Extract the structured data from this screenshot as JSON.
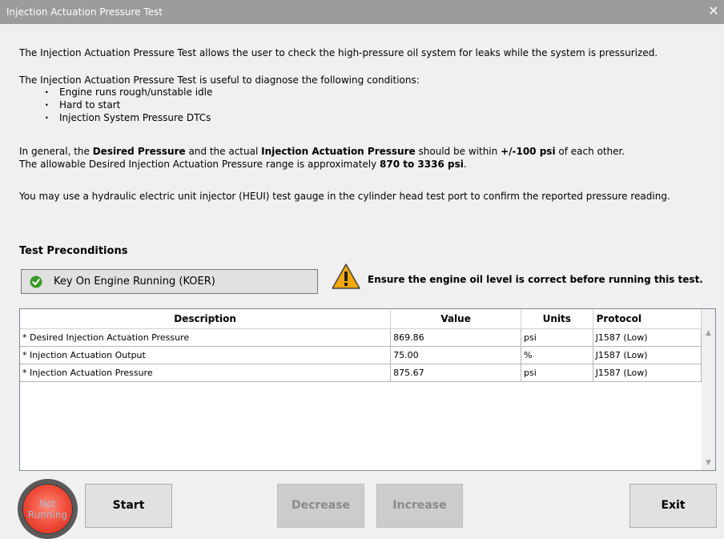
{
  "window": {
    "title": "Injection Actuation Pressure Test",
    "close": "✕"
  },
  "intro": "The Injection Actuation Pressure Test allows the user to check the high-pressure oil system for leaks while the system is pressurized.",
  "conditions": {
    "title": "The Injection Actuation Pressure Test is useful to diagnose the following conditions:",
    "items": [
      "Engine runs rough/unstable idle",
      "Hard to start",
      "Injection System Pressure DTCs"
    ]
  },
  "general": {
    "p1": "In general, the ",
    "b1": "Desired Pressure",
    "p2": " and the actual ",
    "b2": "Injection Actuation Pressure",
    "p3": " should be within ",
    "b3": "+/-100 psi",
    "p4": " of each other."
  },
  "range": {
    "p1": "The allowable Desired Injection Actuation Pressure range is approximately ",
    "b1": "870 to 3336 psi",
    "p2": "."
  },
  "heui": "You may use a hydraulic electric unit injector (HEUI) test gauge in the cylinder head test port to confirm the reported pressure reading.",
  "preconditions": {
    "title": "Test Preconditions",
    "koer": "Key On Engine Running (KOER)",
    "warning": "Ensure the engine oil level is correct before running this test."
  },
  "table": {
    "headers": [
      "Description",
      "Value",
      "Units",
      "Protocol"
    ],
    "rows": [
      [
        "* Desired Injection Actuation Pressure",
        "869.86",
        "psi",
        "J1587 (Low)"
      ],
      [
        "* Injection Actuation Output",
        "75.00",
        "%",
        "J1587 (Low)"
      ],
      [
        "* Injection Actuation Pressure",
        "875.67",
        "psi",
        "J1587 (Low)"
      ]
    ]
  },
  "status": {
    "line1": "Not",
    "line2": "Running",
    "color": "#ef4a36"
  },
  "buttons": {
    "start": "Start",
    "decrease": "Decrease",
    "increase": "Increase",
    "exit": "Exit"
  },
  "icons": {
    "check": "check-circle-icon",
    "warning": "warning-triangle-icon"
  }
}
